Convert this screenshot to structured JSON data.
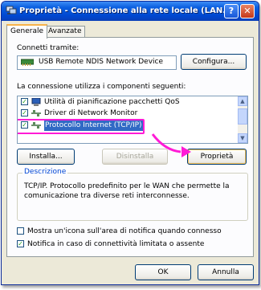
{
  "window": {
    "title": "Proprietà - Connessione alla rete locale (LAN...",
    "help_glyph": "?",
    "close_glyph": "✕"
  },
  "tabs": [
    {
      "label": "Generale",
      "active": true
    },
    {
      "label": "Avanzate",
      "active": false
    }
  ],
  "connect": {
    "label": "Connetti tramite:",
    "device": "USB Remote NDIS Network Device",
    "configure_button": "Configura..."
  },
  "components": {
    "label": "La connessione utilizza i componenti seguenti:",
    "items": [
      {
        "label": "Utilità di pianificazione pacchetti QoS",
        "checked": true,
        "selected": false
      },
      {
        "label": "Driver di Network Monitor",
        "checked": true,
        "selected": false
      },
      {
        "label": "Protocollo Internet (TCP/IP)",
        "checked": true,
        "selected": true
      }
    ],
    "check_glyph": "✓"
  },
  "buttons": {
    "install": "Installa...",
    "uninstall": "Disinstalla",
    "properties": "Proprietà"
  },
  "description": {
    "title": "Descrizione",
    "text": "TCP/IP. Protocollo predefinito per le WAN che permette la comunicazione tra diverse reti interconnesse."
  },
  "options": [
    {
      "label": "Mostra un'icona sull'area di notifica quando connesso",
      "checked": false
    },
    {
      "label": "Notifica in caso di connettività limitata o assente",
      "checked": true
    }
  ],
  "footer": {
    "ok": "OK",
    "cancel": "Annulla"
  },
  "colors": {
    "highlight_annotation": "#ff1bd6",
    "selection": "#316ac5",
    "titlebar": "#0047d0"
  }
}
